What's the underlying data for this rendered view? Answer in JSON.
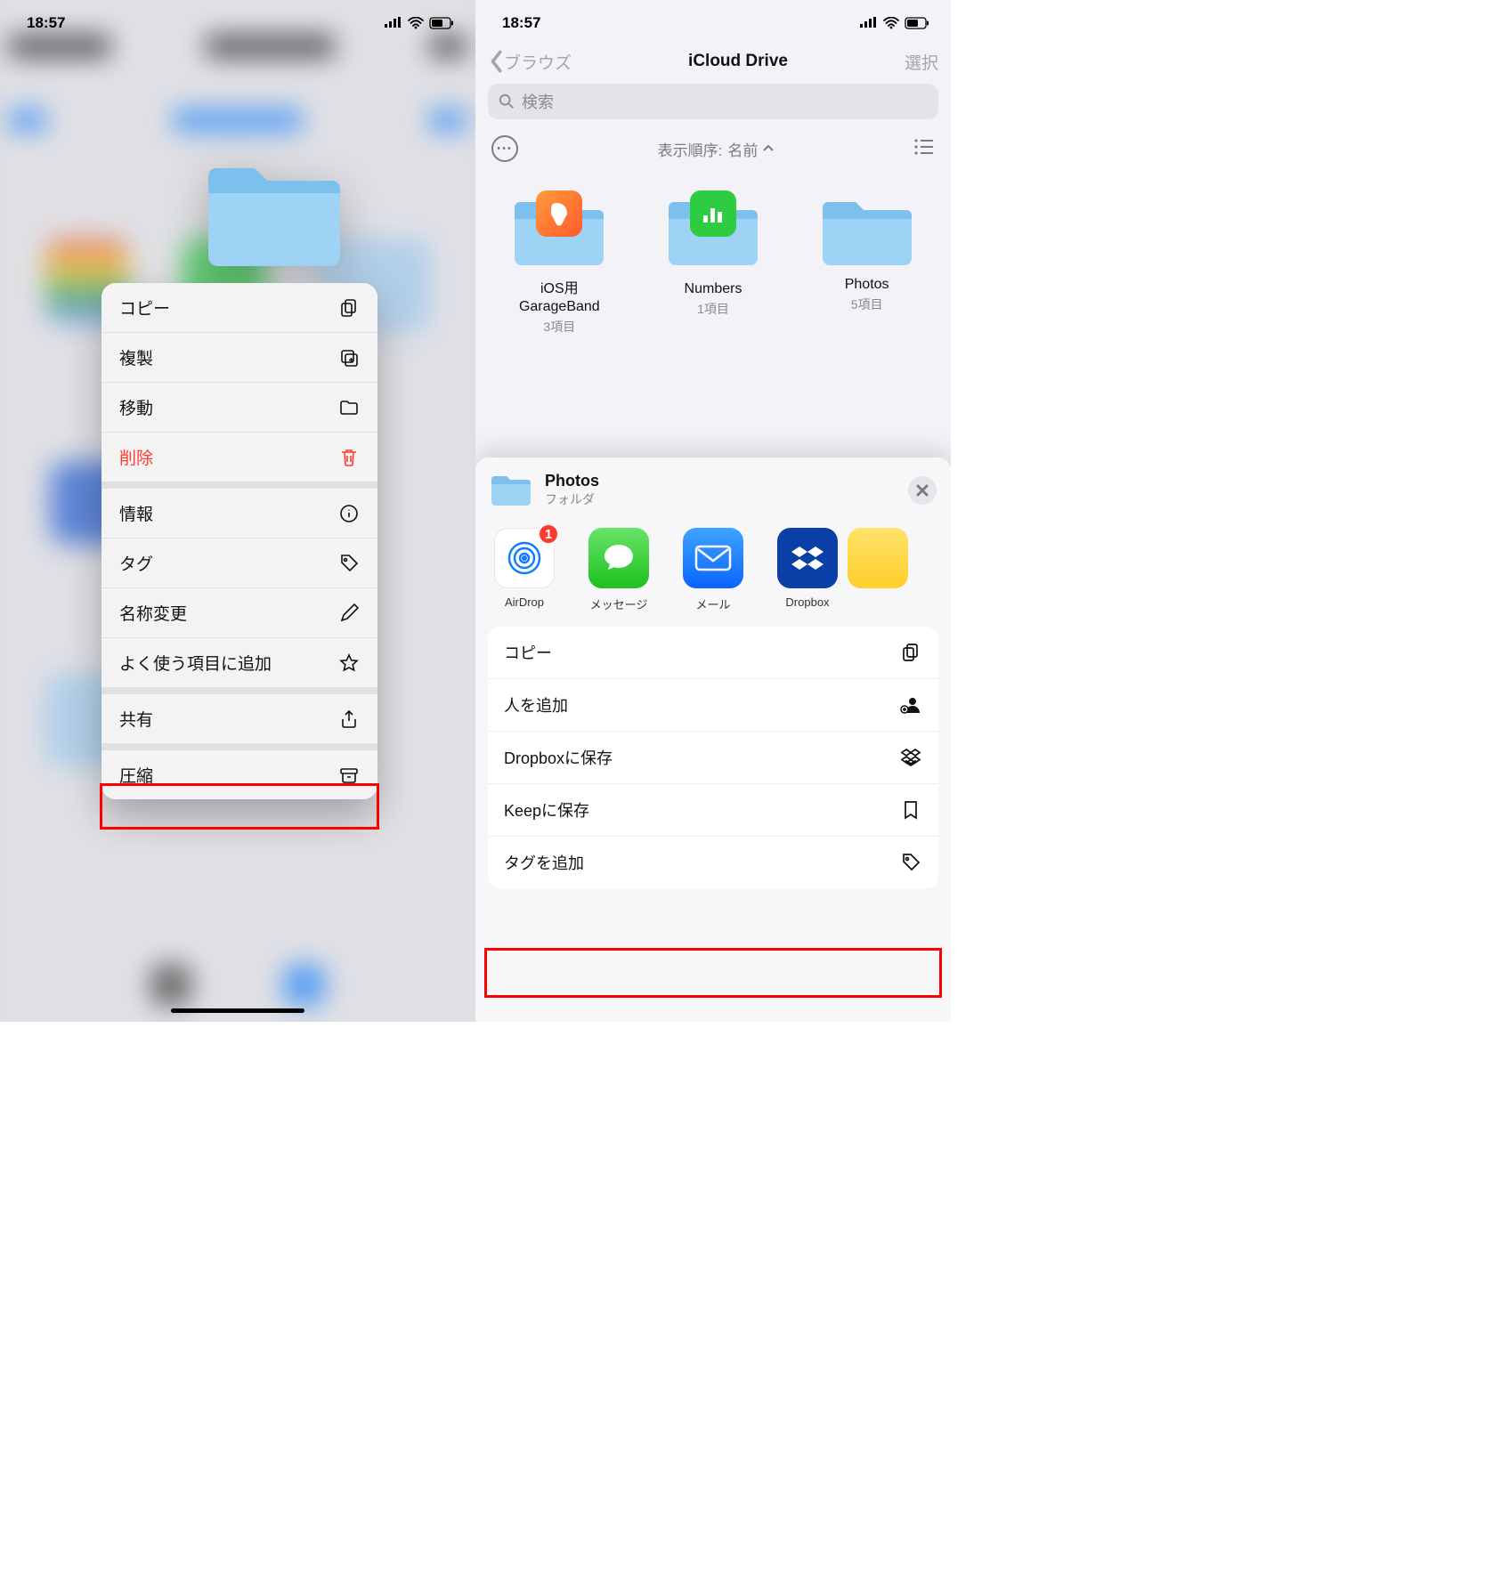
{
  "status": {
    "time": "18:57"
  },
  "left": {
    "context_menu": {
      "copy": "コピー",
      "duplicate": "複製",
      "move": "移動",
      "delete": "削除",
      "info": "情報",
      "tag": "タグ",
      "rename": "名称変更",
      "favorite": "よく使う項目に追加",
      "share": "共有",
      "compress": "圧縮"
    }
  },
  "right": {
    "nav": {
      "back": "ブラウズ",
      "title": "iCloud Drive",
      "select": "選択"
    },
    "search_placeholder": "検索",
    "sort_prefix": "表示順序: ",
    "sort_value": "名前",
    "folders": {
      "gb": {
        "name": "iOS用\nGarageBand",
        "meta": "3項目"
      },
      "numbers": {
        "name": "Numbers",
        "meta": "1項目"
      },
      "photos": {
        "name": "Photos",
        "meta": "5項目"
      }
    },
    "share": {
      "title": "Photos",
      "subtitle": "フォルダ",
      "airdrop_badge": "1",
      "apps": {
        "airdrop": "AirDrop",
        "messages": "メッセージ",
        "mail": "メール",
        "dropbox": "Dropbox"
      },
      "actions": {
        "copy": "コピー",
        "add_people": "人を追加",
        "dropbox": "Dropboxに保存",
        "keep": "Keepに保存",
        "add_tags": "タグを追加"
      }
    }
  }
}
